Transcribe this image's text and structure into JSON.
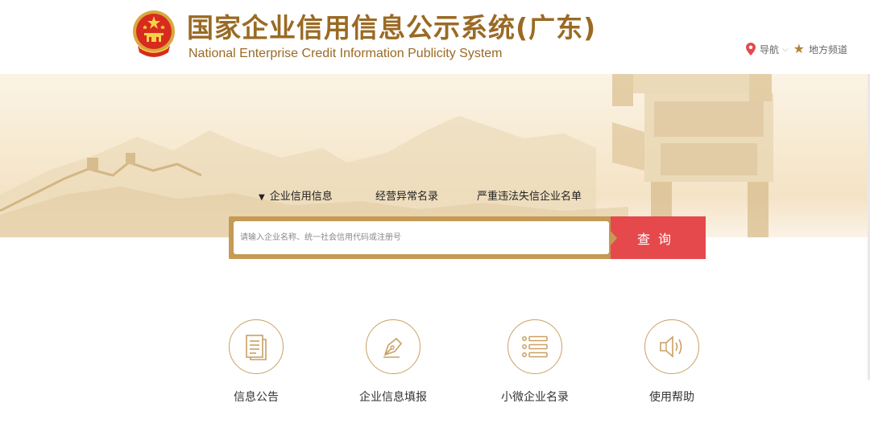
{
  "header": {
    "title_cn": "国家企业信用信息公示系统(广东)",
    "title_en": "National Enterprise Credit Information Publicity System",
    "nav_label": "导航",
    "local_channel_label": "地方频道"
  },
  "search": {
    "tabs": [
      "企业信用信息",
      "经营异常名录",
      "严重违法失信企业名单"
    ],
    "active_tab": "企业信用信息",
    "placeholder": "请输入企业名称、统一社会信用代码或注册号",
    "button_label": "查询"
  },
  "features": [
    {
      "label": "信息公告",
      "icon": "document-icon"
    },
    {
      "label": "企业信息填报",
      "icon": "pen-icon"
    },
    {
      "label": "小微企业名录",
      "icon": "list-icon"
    },
    {
      "label": "使用帮助",
      "icon": "speaker-icon"
    }
  ],
  "colors": {
    "gold": "#9a6a24",
    "search_border": "#c49a55",
    "search_button": "#e5494c",
    "icon_stroke": "#c9a064"
  }
}
